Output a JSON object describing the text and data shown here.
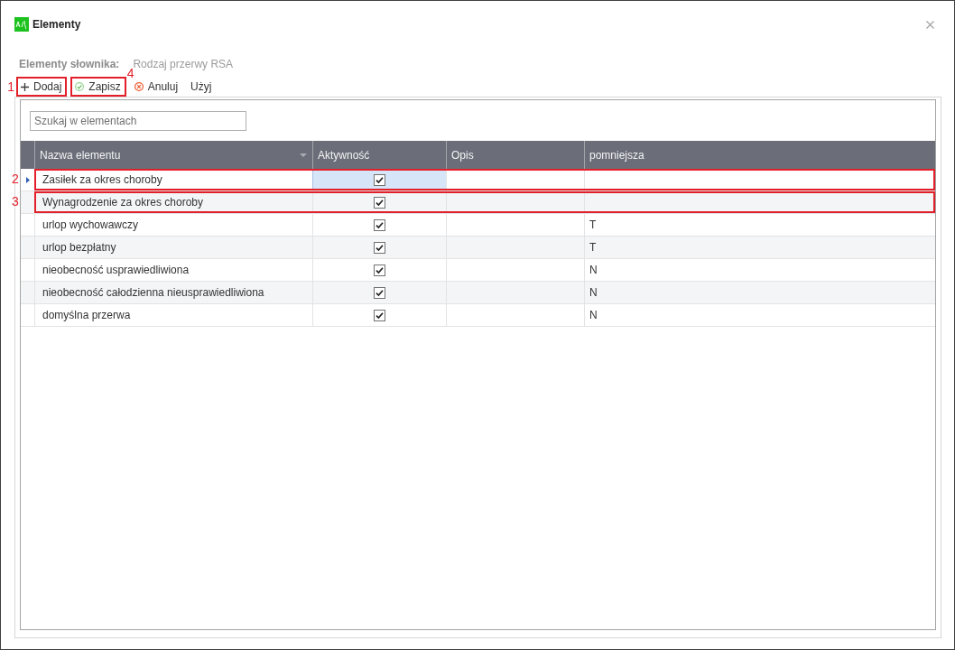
{
  "window": {
    "title": "Elementy"
  },
  "dictionary": {
    "label": "Elementy słownika:",
    "value": "Rodzaj przerwy RSA"
  },
  "toolbar": [
    {
      "kind": "add",
      "label": "Dodaj",
      "callout": "1"
    },
    {
      "kind": "save",
      "label": "Zapisz",
      "callout": "4"
    },
    {
      "kind": "cancel",
      "label": "Anuluj"
    },
    {
      "kind": "use",
      "label": "Użyj"
    }
  ],
  "search": {
    "placeholder": "Szukaj w elementach"
  },
  "table": {
    "columns": [
      {
        "label": "Nazwa elementu",
        "menu": true
      },
      {
        "label": "Aktywność",
        "menu": false
      },
      {
        "label": "Opis",
        "menu": false
      },
      {
        "label": "pomniejsza",
        "menu": false
      }
    ],
    "rows": [
      {
        "name": "Zasiłek za okres choroby",
        "active": true,
        "selected": true,
        "callout": "2"
      },
      {
        "name": "Wynagrodzenie za okres choroby",
        "active": true,
        "selected": false,
        "callout": "3"
      },
      {
        "name": "urlop wychowawczy",
        "active": true,
        "selected": false,
        "pomniejsza": "T"
      },
      {
        "name": "urlop bezpłatny",
        "active": true,
        "selected": false,
        "pomniejsza": "T"
      },
      {
        "name": "nieobecność usprawiedliwiona",
        "active": true,
        "selected": false,
        "pomniejsza": "N"
      },
      {
        "name": "nieobecność całodzienna nieusprawiedliwiona",
        "active": true,
        "selected": false,
        "pomniejsza": "N"
      },
      {
        "name": "domyślna przerwa",
        "active": true,
        "selected": false,
        "pomniejsza": "N"
      }
    ]
  }
}
